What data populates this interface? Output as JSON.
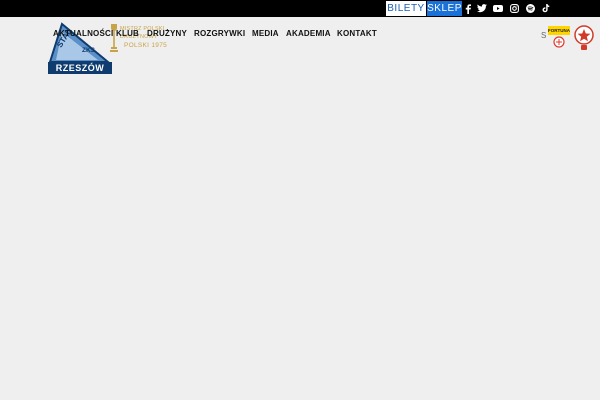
{
  "topbar": {
    "tickets_label": "BILETY",
    "shop_label": "SKLEP",
    "social_icons": [
      "facebook-icon",
      "twitter-icon",
      "youtube-icon",
      "instagram-icon",
      "spotify-icon",
      "tiktok-icon"
    ]
  },
  "nav": {
    "items": [
      {
        "label": "AKTUALNOŚCI"
      },
      {
        "label": "KLUB"
      },
      {
        "label": "DRUŻYNY"
      },
      {
        "label": "ROZGRYWKI"
      },
      {
        "label": "MEDIA"
      },
      {
        "label": "AKADEMIA"
      },
      {
        "label": "KONTAKT"
      }
    ]
  },
  "logo": {
    "letters_top": "STAL",
    "letters_mid": "ZKS",
    "city": "RZESZÓW"
  },
  "championship": {
    "line1": "MISTRZ POLSKI",
    "line2": "DRUŻYNOWY",
    "year_label": "POLSKI 1975"
  },
  "sponsors": {
    "small_mark": "S",
    "fortuna_label": "FORTUNA"
  },
  "colors": {
    "background": "#efefef",
    "topbar": "#000000",
    "accent_blue": "#1a72d9",
    "logo_blue": "#0f3b6e",
    "gold": "#c9a347"
  }
}
